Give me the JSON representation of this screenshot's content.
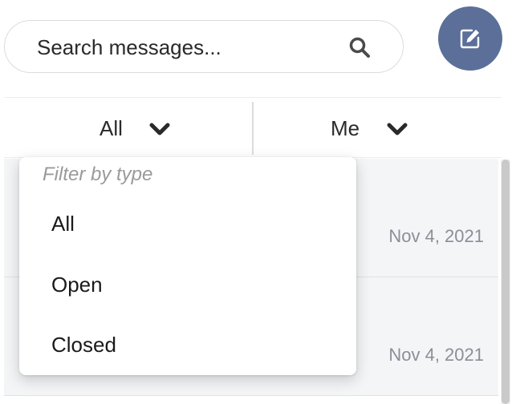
{
  "search": {
    "placeholder": "Search messages...",
    "icon": "search-icon"
  },
  "compose": {
    "icon": "edit-icon",
    "color": "#5b6f99"
  },
  "filters": [
    {
      "label": "All",
      "icon": "chevron-down-icon"
    },
    {
      "label": "Me",
      "icon": "chevron-down-icon"
    }
  ],
  "dropdown": {
    "header": "Filter by type",
    "options": [
      "All",
      "Open",
      "Closed"
    ]
  },
  "messages": [
    {
      "date": "Nov 4, 2021"
    },
    {
      "date": "Nov 4, 2021"
    }
  ]
}
